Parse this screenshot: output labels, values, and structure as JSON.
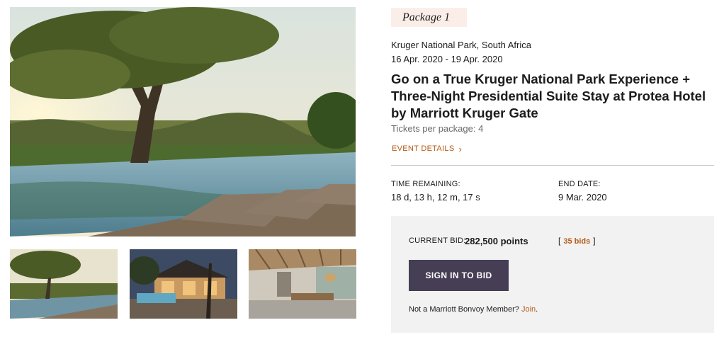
{
  "package_label": "Package 1",
  "location": "Kruger National Park, South Africa",
  "dates": "16 Apr. 2020 - 19 Apr. 2020",
  "title": "Go on a True Kruger National Park Experience + Three-Night Presidential Suite Stay at Protea Hotel by Marriott Kruger Gate",
  "tickets": "Tickets per package: 4",
  "event_details_link": "EVENT DETAILS",
  "time_remaining": {
    "label": "TIME REMAINING:",
    "value": "18 d, 13 h, 12 m, 17 s"
  },
  "end_date": {
    "label": "END DATE:",
    "value": "9 Mar. 2020"
  },
  "bid": {
    "current_label": "CURRENT BID:",
    "current_value": "282,500 points",
    "bids_count": "35 bids",
    "bracket_open": "[",
    "bracket_close": "]",
    "signin_button": "SIGN IN TO BID",
    "member_prompt": "Not a Marriott Bonvoy Member?",
    "join_link": "Join",
    "join_suffix": "."
  },
  "colors": {
    "accent": "#b65b17",
    "button_bg": "#463e55",
    "badge_bg": "#fbeee9",
    "bid_box_bg": "#f2f2f2"
  }
}
